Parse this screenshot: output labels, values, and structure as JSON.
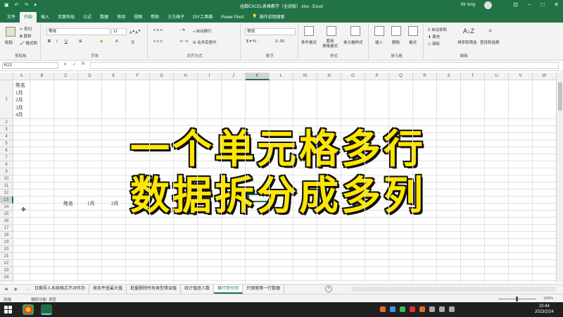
{
  "titlebar": {
    "title": "函数EXCEL表格教学（全班版）.xlsx - Excel",
    "user": "Mr long",
    "qat_icons": [
      "save-icon",
      "undo-icon",
      "redo-icon",
      "customize-icon"
    ]
  },
  "ribbon_tabs": [
    {
      "label": "文件"
    },
    {
      "label": "开始",
      "active": true
    },
    {
      "label": "插入"
    },
    {
      "label": "页面布局"
    },
    {
      "label": "公式"
    },
    {
      "label": "数据"
    },
    {
      "label": "审阅"
    },
    {
      "label": "视图"
    },
    {
      "label": "帮助"
    },
    {
      "label": "方方格子"
    },
    {
      "label": "DIY工具箱"
    },
    {
      "label": "Power Pivot"
    },
    {
      "label": "操作说明搜索"
    }
  ],
  "ribbon": {
    "clipboard": {
      "paste": "粘贴",
      "cut": "剪切",
      "copy": "复制",
      "format_painter": "格式刷",
      "label": "剪贴板"
    },
    "font": {
      "name": "等线",
      "size": "11",
      "label": "字体"
    },
    "alignment": {
      "wrap": "自动换行",
      "merge": "合并后居中",
      "label": "对齐方式"
    },
    "number": {
      "format": "常规",
      "label": "数字"
    },
    "styles": {
      "conditional": "条件格式",
      "table": "套用\n表格格式",
      "cell": "单元格样式",
      "label": "样式"
    },
    "cells": {
      "insert": "插入",
      "delete": "删除",
      "format": "格式",
      "label": "单元格"
    },
    "editing": {
      "autosum": "自动求和",
      "fill": "填充",
      "clear": "清除",
      "sort": "排序和筛选",
      "find": "查找和选择",
      "label": "编辑"
    }
  },
  "formula_bar": {
    "name_box": "K13",
    "fx": "fx",
    "formula": ""
  },
  "columns": [
    "A",
    "B",
    "C",
    "D",
    "E",
    "F",
    "G",
    "H",
    "I",
    "J",
    "K",
    "L",
    "M",
    "N",
    "O",
    "P",
    "Q",
    "R",
    "S",
    "T",
    "U",
    "V",
    "W"
  ],
  "selected_column": "K",
  "rows": [
    "1",
    "2",
    "3",
    "4",
    "5",
    "6",
    "7",
    "8",
    "9",
    "10",
    "11",
    "12",
    "13",
    "14",
    "15",
    "16",
    "17",
    "18",
    "19",
    "20",
    "21",
    "22",
    "23",
    "24",
    "25",
    "26",
    "27",
    "28"
  ],
  "selected_row": "13",
  "cells": {
    "a1_lines": [
      "姓名",
      "1月",
      "2月",
      "3月",
      "4月"
    ],
    "c3": "姓名",
    "d3": "1月",
    "e3": "2月"
  },
  "overlay": {
    "line1": "一个单元格多行",
    "line2": "数据拆分成多列"
  },
  "sheet_tabs": [
    {
      "label": "日期导入系统格式不对咋办"
    },
    {
      "label": "按条件查最大值"
    },
    {
      "label": "批量删除所有类型错误值"
    },
    {
      "label": "统计值班人数"
    },
    {
      "label": "换行符分列",
      "active": true
    },
    {
      "label": "只保留第一行数据"
    }
  ],
  "status": {
    "mode": "就绪",
    "accessibility": "辅助功能: 调查",
    "zoom": "100%"
  },
  "taskbar": {
    "time": "23:44",
    "date": "2023/2/24"
  },
  "colors": {
    "accent": "#217346",
    "overlay_text": "#ffe600",
    "overlay_stroke": "#111111"
  }
}
